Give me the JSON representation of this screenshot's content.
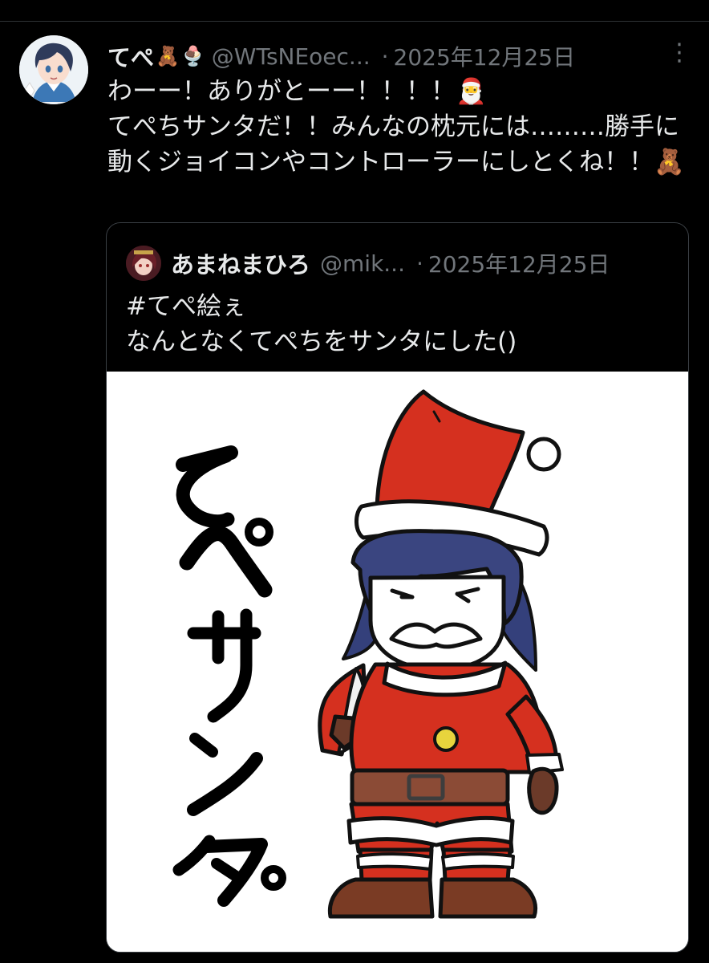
{
  "tweet": {
    "author_name": "てぺ",
    "name_emojis": [
      "🧸",
      "🍨"
    ],
    "handle": "@WTsNEoec...",
    "separator": "·",
    "date": "2025年12月25日",
    "more_icon": "⋮",
    "text": "わーー！ありがとーー！！！！🎅\nてぺちサンタだ！！みんなの枕元には………勝手に動くジョイコンやコントローラーにしとくね！！🧸"
  },
  "quote": {
    "author_name": "あまねまひろ",
    "handle": "@mik...",
    "separator": "·",
    "date": "2025年12月25日",
    "text": "#てぺ絵ぇ\nなんとなくてぺちをサンタにした()"
  },
  "image": {
    "handwritten_text": "てぺサンタ。"
  },
  "colors": {
    "background": "#000000",
    "secondary_text": "#71767b",
    "santa_red": "#c9291d",
    "hair": "#313c68"
  }
}
